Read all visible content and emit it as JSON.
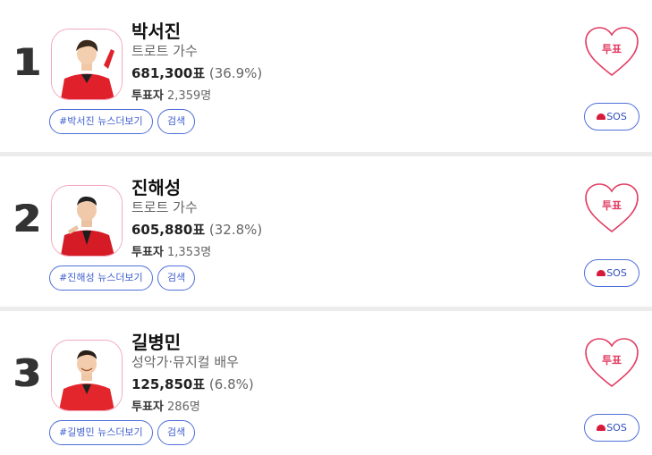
{
  "candidates": [
    {
      "rank": "1",
      "name": "박서진",
      "role": "트로트 가수",
      "votes": "681,300표",
      "percent": "(36.9%)",
      "voters_label": "투표자",
      "voters": "2,359명",
      "news_tag": "#박서진 뉴스더보기",
      "search_label": "검색",
      "vote_label": "투표",
      "sos_label": "SOS"
    },
    {
      "rank": "2",
      "name": "진해성",
      "role": "트로트 가수",
      "votes": "605,880표",
      "percent": "(32.8%)",
      "voters_label": "투표자",
      "voters": "1,353명",
      "news_tag": "#진해성 뉴스더보기",
      "search_label": "검색",
      "vote_label": "투표",
      "sos_label": "SOS"
    },
    {
      "rank": "3",
      "name": "길병민",
      "role": "성악가·뮤지컬 배우",
      "votes": "125,850표",
      "percent": "(6.8%)",
      "voters_label": "투표자",
      "voters": "286명",
      "news_tag": "#길병민 뉴스더보기",
      "search_label": "검색",
      "vote_label": "투표",
      "sos_label": "SOS"
    }
  ],
  "colors": {
    "accent_blue": "#4f6fd8",
    "heart_pink": "#e23c62",
    "avatar_border": "#f3a8c0",
    "separator": "#ececec"
  },
  "icons": {
    "heart": "heart-icon",
    "sos": "siren-icon",
    "avatar": "person-avatar"
  }
}
